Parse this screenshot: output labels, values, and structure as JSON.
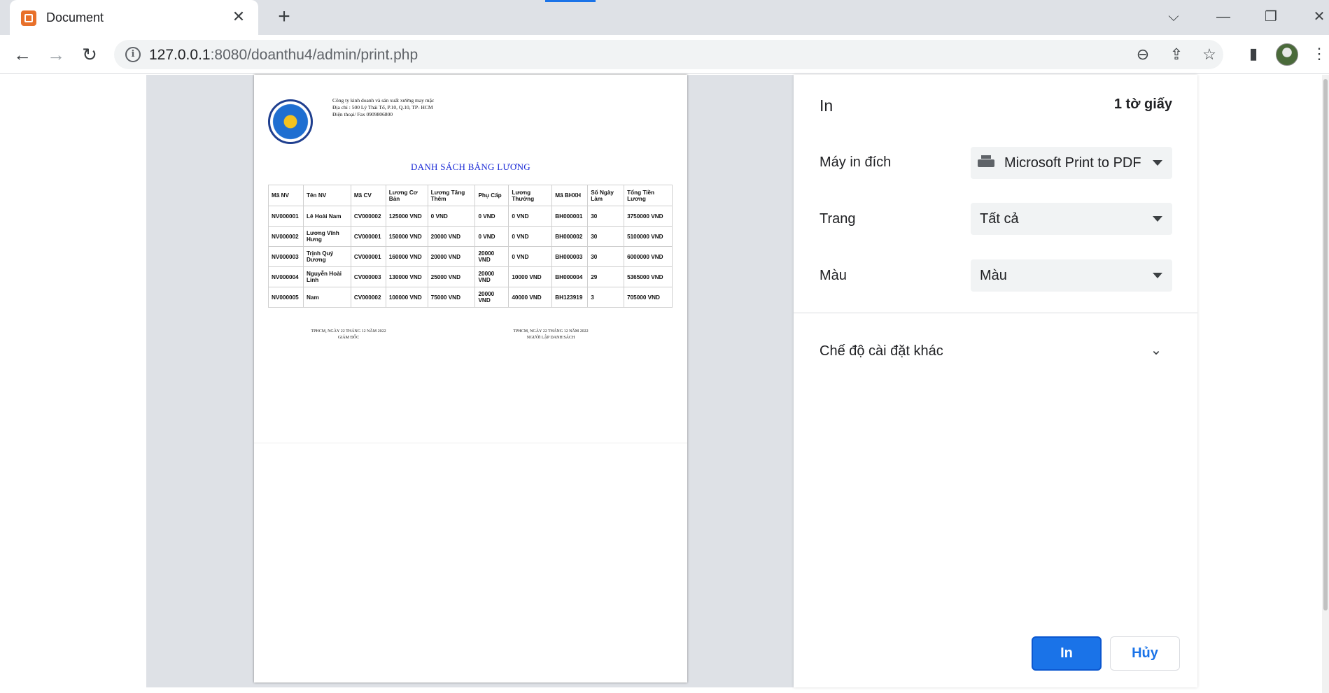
{
  "browser": {
    "tab_title": "Document",
    "tab_close": "✕",
    "new_tab": "+",
    "address_host": "127.0.0.1",
    "address_rest": ":8080/doanthu4/admin/print.php",
    "controls": {
      "tab_search": "⌵",
      "minimize": "—",
      "restore": "❐",
      "close": "✕"
    },
    "nav": {
      "back": "←",
      "forward": "→",
      "reload": "↻"
    },
    "icons": {
      "zoom": "⊖",
      "share": "⇪",
      "bookmark": "☆",
      "sidepanel": "▮",
      "menu": "⋮",
      "info": "i"
    }
  },
  "document": {
    "company_lines": [
      "Công ty kinh doanh và sản xuất xưởng may mặc",
      "Địa chỉ : 500 Lý Thái Tổ, P.10, Q.10, TP- HCM",
      "Điện thoại/ Fax 0909806800"
    ],
    "title": "DANH SÁCH BẢNG LƯƠNG",
    "headers": [
      "Mã NV",
      "Tên NV",
      "Mã CV",
      "Lương Cơ Bản",
      "Lương Tăng Thêm",
      "Phụ Cấp",
      "Lương Thưởng",
      "Mã BHXH",
      "Số Ngày Làm",
      "Tổng Tiền Lương"
    ],
    "rows": [
      [
        "NV000001",
        "Lê Hoài Nam",
        "CV000002",
        "125000 VND",
        "0 VND",
        "0 VND",
        "0 VND",
        "BH000001",
        "30",
        "3750000 VND"
      ],
      [
        "NV000002",
        "Lương Vĩnh Hưng",
        "CV000001",
        "150000 VND",
        "20000 VND",
        "0 VND",
        "0 VND",
        "BH000002",
        "30",
        "5100000 VND"
      ],
      [
        "NV000003",
        "Trịnh Quý Dương",
        "CV000001",
        "160000 VND",
        "20000 VND",
        "20000 VND",
        "0 VND",
        "BH000003",
        "30",
        "6000000 VND"
      ],
      [
        "NV000004",
        "Nguyễn Hoài Linh",
        "CV000003",
        "130000 VND",
        "25000 VND",
        "20000 VND",
        "10000 VND",
        "BH000004",
        "29",
        "5365000 VND"
      ],
      [
        "NV000005",
        "Nam",
        "CV000002",
        "100000 VND",
        "75000 VND",
        "20000 VND",
        "40000 VND",
        "BH123919",
        "3",
        "705000 VND"
      ]
    ],
    "signature_left": {
      "date": "TPHCM, NGÀY 22 THÁNG 12 NĂM 2022",
      "role": "GIÁM ĐỐC"
    },
    "signature_right": {
      "date": "TPHCM, NGÀY 22 THÁNG 12 NĂM 2022",
      "role": "NGƯỜI LẬP DANH SÁCH"
    }
  },
  "print_panel": {
    "title": "In",
    "sheets": "1 tờ giấy",
    "destination_label": "Máy in đích",
    "destination_value": "Microsoft Print to PDF",
    "pages_label": "Trang",
    "pages_value": "Tất cả",
    "color_label": "Màu",
    "color_value": "Màu",
    "more_settings": "Chế độ cài đặt khác",
    "print_button": "In",
    "cancel_button": "Hủy",
    "accent_color": "#1a73e8"
  }
}
